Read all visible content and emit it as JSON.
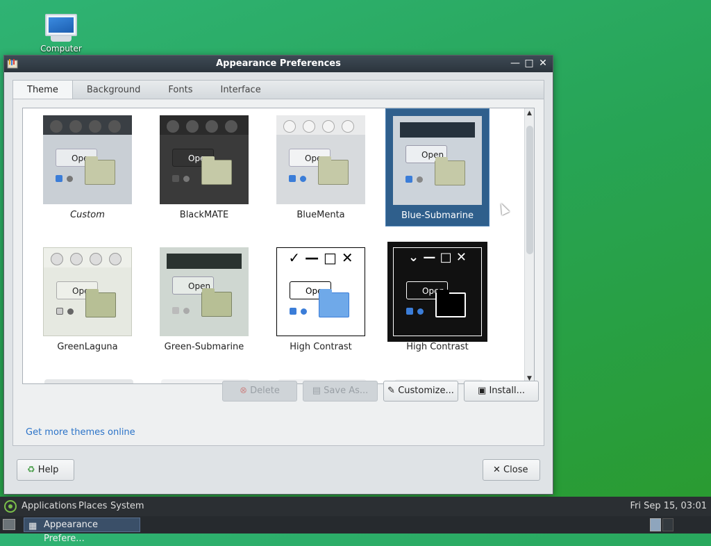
{
  "desktop": {
    "icon_label": "Computer"
  },
  "window": {
    "title": "Appearance Preferences",
    "controls": {
      "minimize": "—",
      "maximize": "□",
      "close": "✕"
    }
  },
  "tabs": [
    {
      "label": "Theme",
      "active": true
    },
    {
      "label": "Background",
      "active": false
    },
    {
      "label": "Fonts",
      "active": false
    },
    {
      "label": "Interface",
      "active": false
    }
  ],
  "themes": [
    {
      "name": "Custom",
      "style": "italic",
      "selected": false,
      "preview_open_label": "Open"
    },
    {
      "name": "BlackMATE",
      "selected": false,
      "preview_open_label": "Open"
    },
    {
      "name": "BlueMenta",
      "selected": false,
      "preview_open_label": "Open"
    },
    {
      "name": "Blue-Submarine",
      "selected": true,
      "preview_open_label": "Open"
    },
    {
      "name": "GreenLaguna",
      "selected": false,
      "preview_open_label": "Open"
    },
    {
      "name": "Green-Submarine",
      "selected": false,
      "preview_open_label": "Open"
    },
    {
      "name": "High Contrast",
      "selected": false,
      "preview_open_label": "Open"
    },
    {
      "name": "High Contrast",
      "selected": false,
      "preview_open_label": "Open"
    }
  ],
  "actions": {
    "delete": "Delete",
    "save_as": "Save As...",
    "customize": "Customize...",
    "install": "Install..."
  },
  "more_themes_link": "Get more themes online",
  "dialog_buttons": {
    "help": "Help",
    "close": "Close"
  },
  "panel": {
    "menus": [
      "Applications",
      "Places",
      "System"
    ],
    "clock": "Fri Sep 15, 03:01",
    "task_label": "Appearance Prefere..."
  },
  "colors": {
    "selection": "#2f5f8c",
    "link": "#2b73c8",
    "desktop_green": "#27a455"
  }
}
